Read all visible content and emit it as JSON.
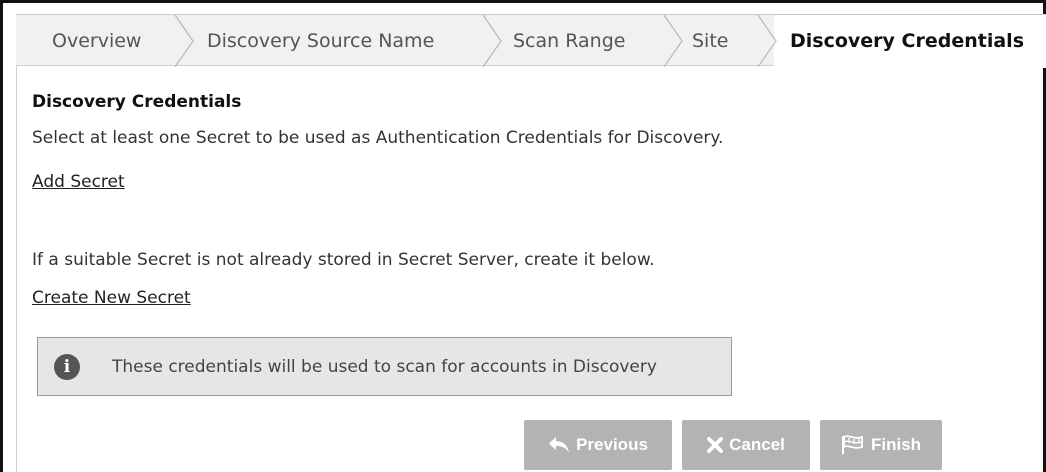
{
  "tabs": [
    {
      "label": "Overview",
      "active": false
    },
    {
      "label": "Discovery Source Name",
      "active": false
    },
    {
      "label": "Scan Range",
      "active": false
    },
    {
      "label": "Site",
      "active": false
    },
    {
      "label": "Discovery Credentials",
      "active": true
    }
  ],
  "section": {
    "title": "Discovery Credentials",
    "instruction": "Select at least one Secret to be used as Authentication Credentials for Discovery.",
    "add_secret_link": "Add Secret",
    "create_hint": "If a suitable Secret is not already stored in Secret Server, create it below.",
    "create_secret_link": "Create New Secret"
  },
  "info": {
    "icon": "info-icon",
    "message": "These credentials will be used to scan for accounts in Discovery"
  },
  "buttons": {
    "previous": {
      "label": "Previous",
      "icon": "reply-arrow-icon"
    },
    "cancel": {
      "label": "Cancel",
      "icon": "x-icon"
    },
    "finish": {
      "label": "Finish",
      "icon": "checkered-flag-icon"
    }
  },
  "colors": {
    "button_disabled": "#b3b3b3",
    "tab_strip": "#f1f1f1",
    "info_bg": "#e6e6e6",
    "info_icon": "#555555"
  }
}
